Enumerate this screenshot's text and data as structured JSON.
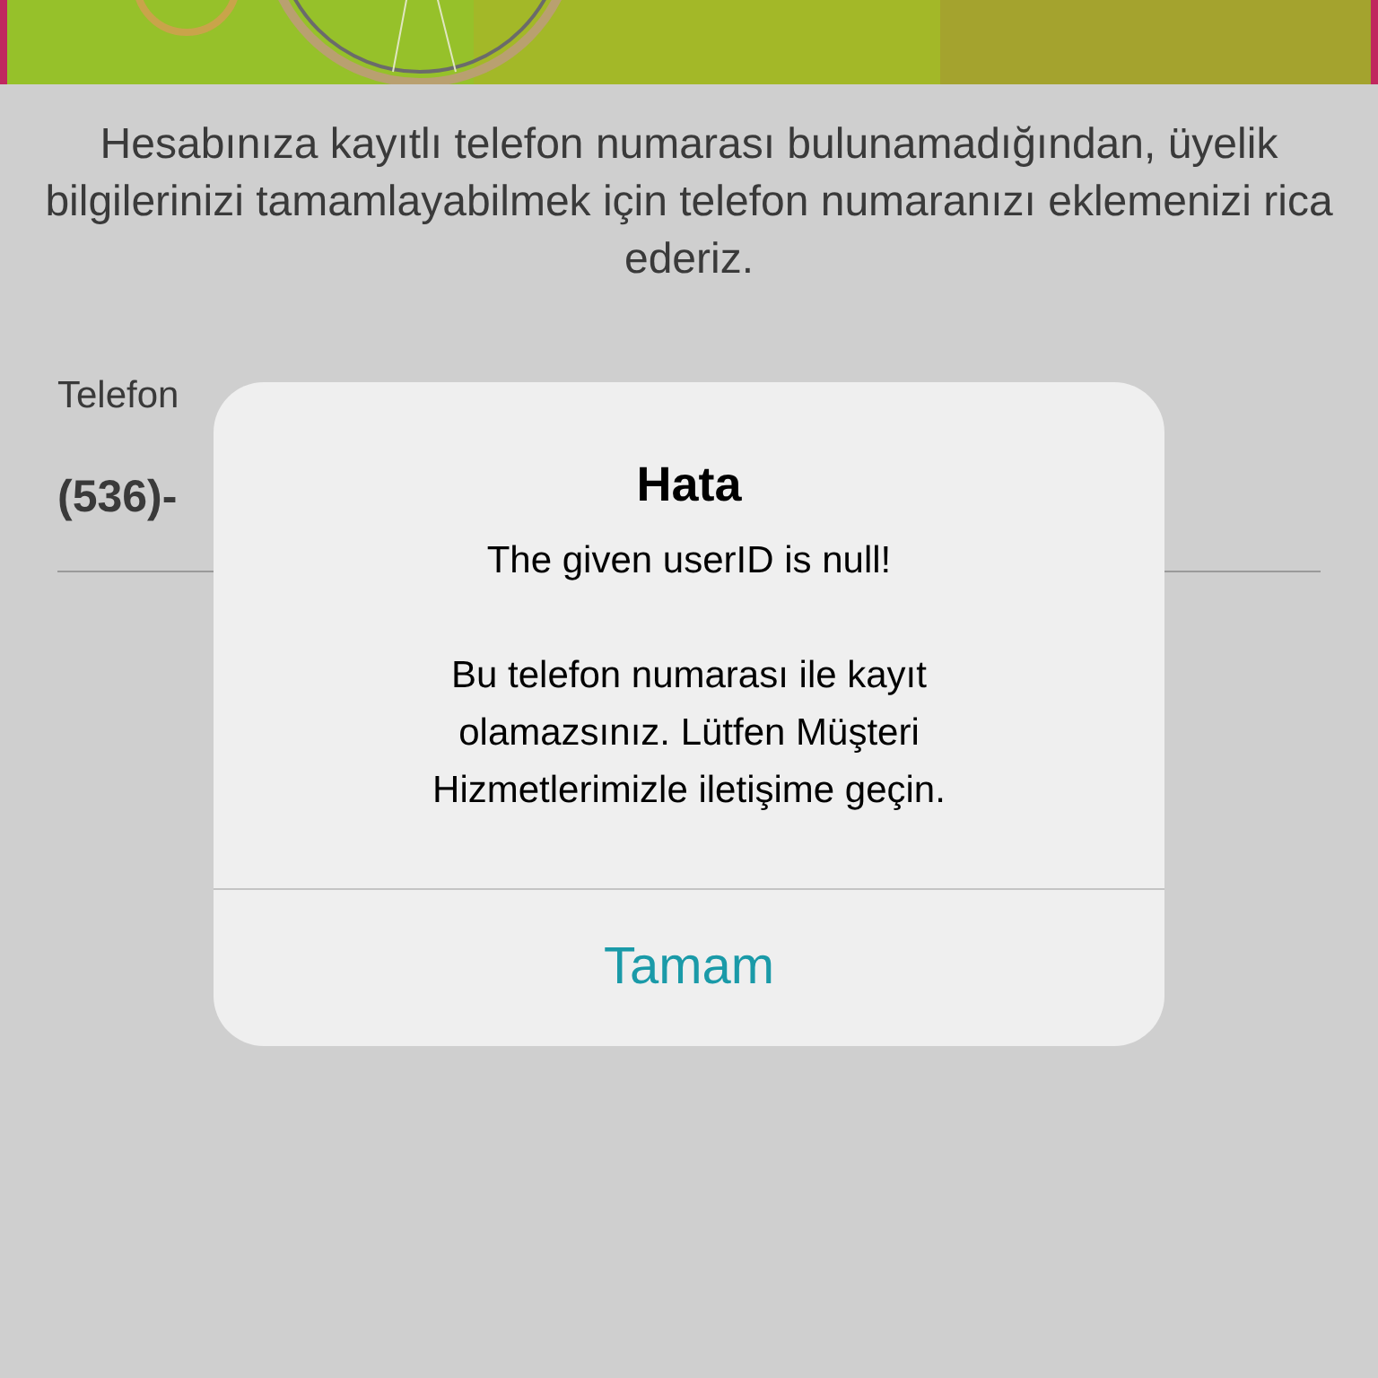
{
  "description": "Hesabınıza kayıtlı telefon numarası bulunamadığından, üyelik bilgilerinizi tamamlayabilmek için telefon numaranızı eklemenizi rica ederiz.",
  "phone_field": {
    "label": "Telefon",
    "value": "(536)-"
  },
  "alert": {
    "title": "Hata",
    "message": [
      "The given userID is null!",
      "Bu telefon numarası ile kayıt olamazsınız. Lütfen Müşteri Hizmetlerimizle iletişime geçin."
    ],
    "buttons": [
      "Tamam"
    ]
  }
}
